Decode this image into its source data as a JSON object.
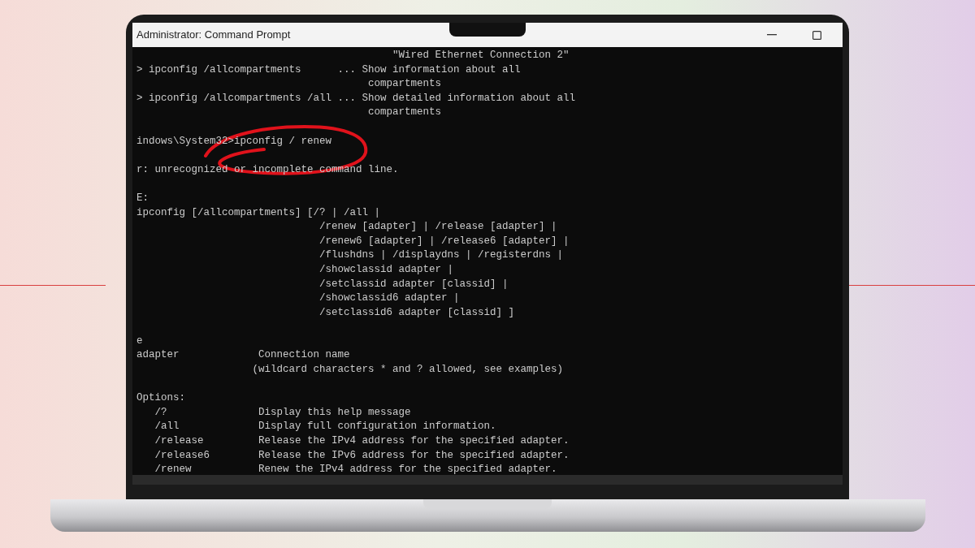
{
  "window": {
    "title": "Administrator: Command Prompt"
  },
  "terminal": {
    "blocks": [
      {
        "lines": [
          "                                          \"Wired Ethernet Connection 2\"",
          "> ipconfig /allcompartments      ... Show information about all",
          "                                      compartments",
          "> ipconfig /allcompartments /all ... Show detailed information about all",
          "                                      compartments"
        ]
      },
      {
        "lines": [
          "indows\\System32>ipconfig / renew"
        ]
      },
      {
        "lines": [
          "r: unrecognized or incomplete command line."
        ]
      },
      {
        "lines": [
          "E:",
          "ipconfig [/allcompartments] [/? | /all |",
          "                              /renew [adapter] | /release [adapter] |",
          "                              /renew6 [adapter] | /release6 [adapter] |",
          "                              /flushdns | /displaydns | /registerdns |",
          "                              /showclassid adapter |",
          "                              /setclassid adapter [classid] |",
          "                              /showclassid6 adapter |",
          "                              /setclassid6 adapter [classid] ]"
        ]
      },
      {
        "lines": [
          "e",
          "adapter             Connection name",
          "                   (wildcard characters * and ? allowed, see examples)"
        ]
      },
      {
        "lines": [
          "Options:",
          "   /?               Display this help message",
          "   /all             Display full configuration information.",
          "   /release         Release the IPv4 address for the specified adapter.",
          "   /release6        Release the IPv6 address for the specified adapter.",
          "   /renew           Renew the IPv4 address for the specified adapter."
        ]
      }
    ]
  }
}
